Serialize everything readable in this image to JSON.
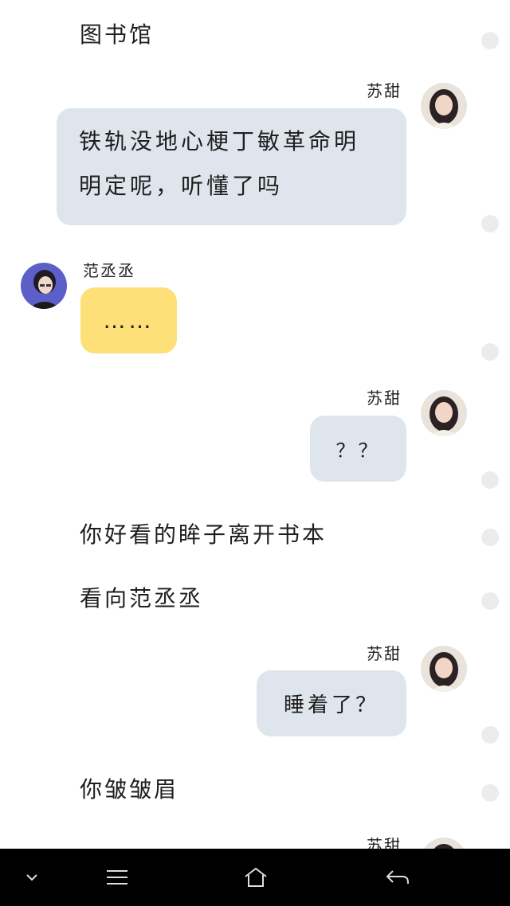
{
  "messages": {
    "narration_library": "图书馆",
    "sender_sutian": "苏甜",
    "sender_fanchengcheng": "范丞丞",
    "msg1": "铁轨没地心梗丁敏革命明明定呢，听懂了吗",
    "msg1_line1": "铁轨没地心梗丁敏革命明",
    "msg1_line2": "明定呢，听懂了吗",
    "msg2": "……",
    "msg3": "？？",
    "narration_2": "你好看的眸子离开书本",
    "narration_3": "看向范丞丞",
    "msg4": "睡着了？",
    "narration_4": "你皱皱眉"
  },
  "icons": {
    "avatar_female": "girl-avatar",
    "avatar_male": "boy-avatar",
    "nav_down": "chevron-down-icon",
    "nav_menu": "menu-icon",
    "nav_home": "home-icon",
    "nav_back": "back-icon"
  },
  "colors": {
    "blue_bubble": "#dfe5ec",
    "yellow_bubble": "#fde078",
    "navbar": "#000000"
  }
}
